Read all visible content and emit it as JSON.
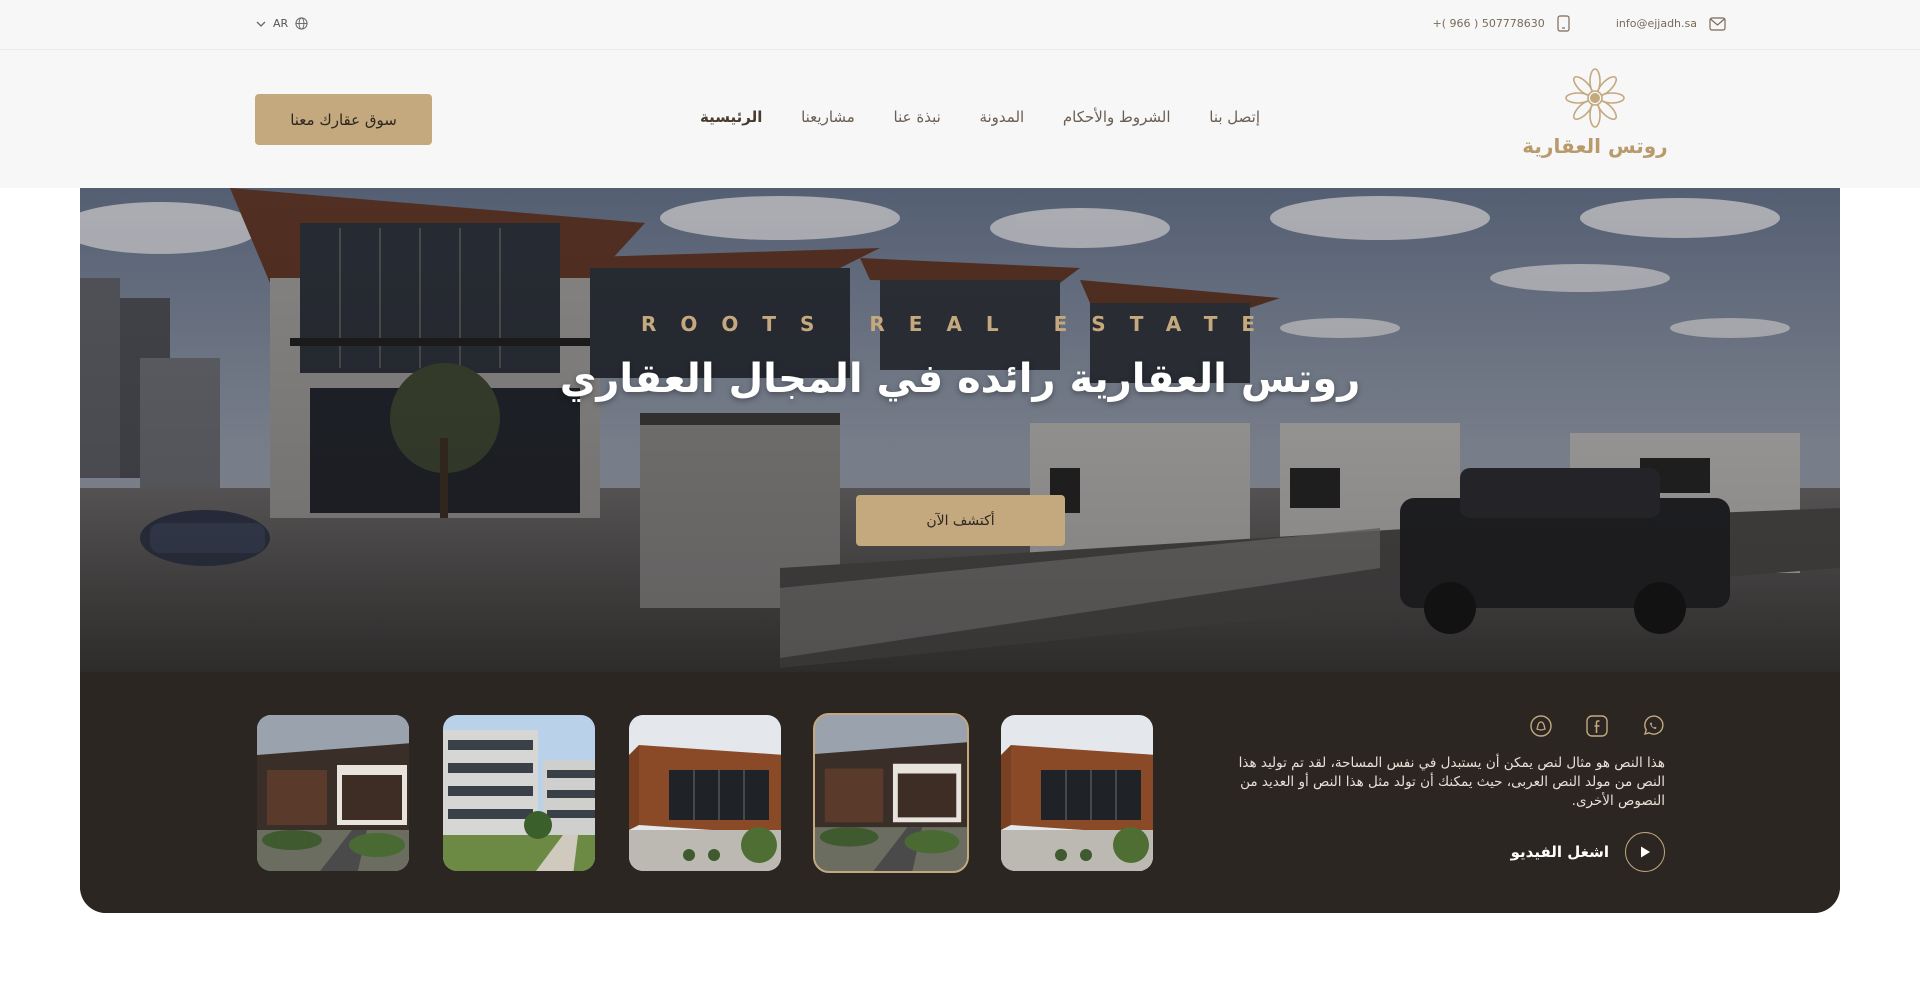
{
  "topbar": {
    "lang_label": "AR",
    "email": "info@ejjadh.sa",
    "phone": "+( 966 ) 507778630"
  },
  "header": {
    "logo_text": "روتس العقارية",
    "cta_label": "سوق عقارك معنا",
    "nav": [
      {
        "label": "الرئيسية",
        "active": true
      },
      {
        "label": "مشاريعنا"
      },
      {
        "label": "نبذة عنا"
      },
      {
        "label": "المدونة"
      },
      {
        "label": "الشروط والأحكام"
      },
      {
        "label": "إتصل بنا"
      }
    ]
  },
  "hero": {
    "eyebrow": "ROOTS REAL ESTATE",
    "title": "روتس العقارية رائده في المجال العقاري",
    "explore_label": "أكتشف الآن",
    "description": "هذا النص هو مثال لنص يمكن أن يستبدل في نفس المساحة، لقد تم توليد هذا النص من مولد النص العربى، حيث يمكنك أن تولد مثل هذا النص أو العديد من النصوص الأخرى.",
    "video_label": "اشغل الفيديو",
    "socials": [
      "whatsapp-icon",
      "facebook-icon",
      "snapchat-icon"
    ],
    "active_thumbnail": 4
  },
  "colors": {
    "accent": "#c4a97f",
    "band": "#2c2623",
    "bar": "#f7f7f7"
  }
}
